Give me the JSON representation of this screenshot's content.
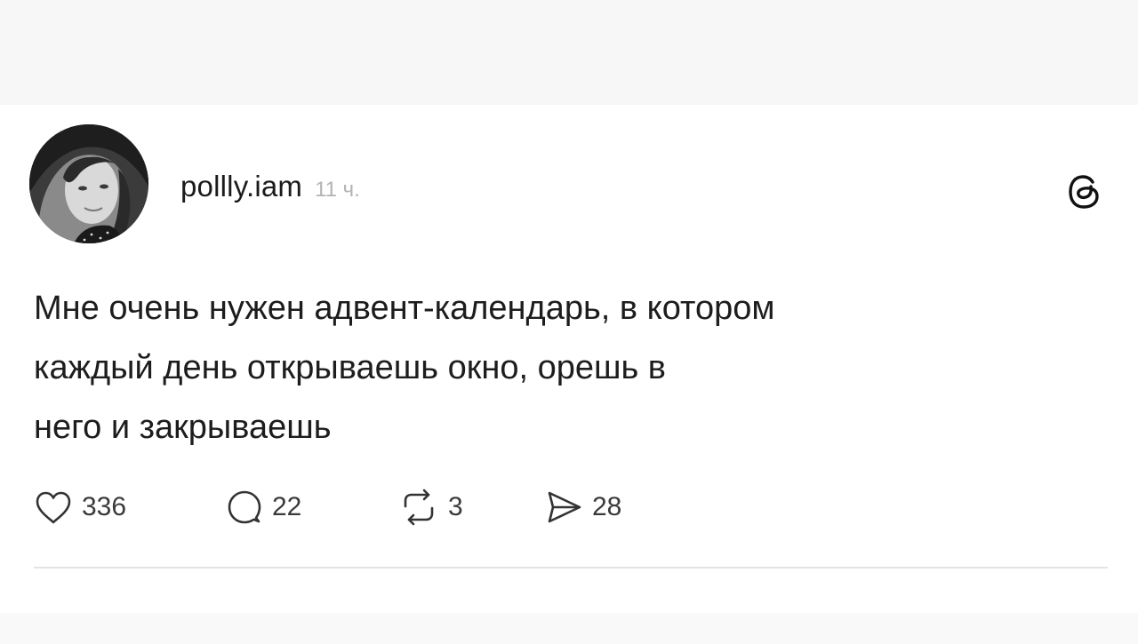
{
  "post": {
    "author": {
      "username": "pollly.iam",
      "time_ago": "11 ч.",
      "avatar_icon": "user-avatar-photo"
    },
    "platform_icon": "threads-icon",
    "text_lines": [
      "Мне очень нужен адвент-календарь, в котором",
      "каждый день открываешь окно, орешь в",
      "него и закрываешь"
    ],
    "actions": {
      "likes": "336",
      "comments": "22",
      "reposts": "3",
      "shares": "28"
    }
  },
  "colors": {
    "text": "#1d1d1d",
    "muted": "#b3b3b3",
    "divider": "#e4e4e4",
    "top_band": "#f7f7f7"
  }
}
